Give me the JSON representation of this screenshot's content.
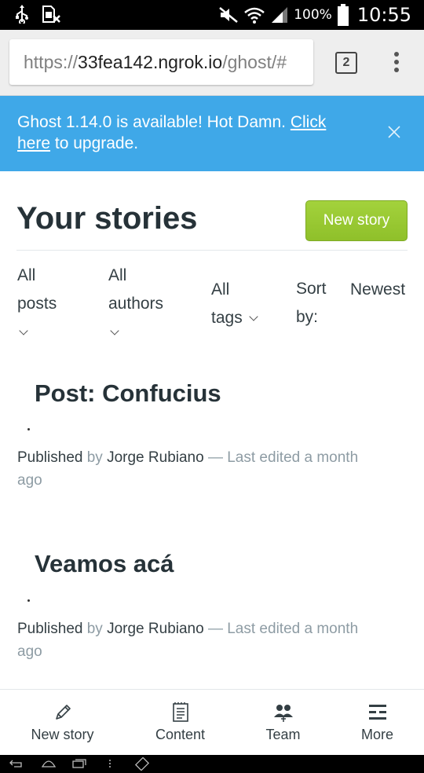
{
  "status_bar": {
    "battery": "100%",
    "time": "10:55",
    "icons": [
      "usb-icon",
      "sim-off-icon",
      "mute-icon",
      "wifi-icon",
      "signal-icon",
      "battery-icon"
    ]
  },
  "browser": {
    "url_scheme": "https://",
    "url_host": "33fea142.ngrok.io",
    "url_path": "/ghost/#",
    "tab_count": "2"
  },
  "notice": {
    "text": "Ghost 1.14.0 is available! Hot Damn. ",
    "link1": "Click",
    "link2": "here",
    "after": " to upgrade."
  },
  "header": {
    "title": "Your stories",
    "new_story": "New story"
  },
  "filters": {
    "posts_line1": "All",
    "posts_line2": "posts",
    "authors_line1": "All",
    "authors_line2": "authors",
    "tags_line1": "All",
    "tags_line2": "tags",
    "sort_line1": "Sort",
    "sort_line2": "by:",
    "sort_value": "Newest"
  },
  "posts": [
    {
      "title": "Post: Confucius",
      "status": "Published",
      "by": "by",
      "author": "Jorge Rubiano",
      "edited": " — Last edited a month",
      "edited2": "ago"
    },
    {
      "title": "Veamos acá",
      "status": "Published",
      "by": "by",
      "author": "Jorge Rubiano",
      "edited": " — Last edited a month",
      "edited2": "ago"
    }
  ],
  "bottom_nav": [
    {
      "label": "New story",
      "icon": "pencil-icon"
    },
    {
      "label": "Content",
      "icon": "document-icon"
    },
    {
      "label": "Team",
      "icon": "team-icon"
    },
    {
      "label": "More",
      "icon": "more-icon"
    }
  ]
}
